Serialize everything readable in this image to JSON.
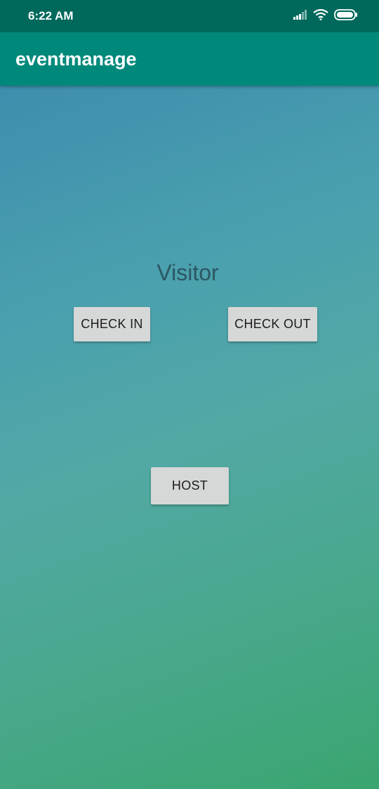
{
  "status_bar": {
    "time": "6:22 AM",
    "icons": [
      "signal-icon",
      "wifi-icon",
      "battery-icon"
    ]
  },
  "app_bar": {
    "title": "eventmanage"
  },
  "main": {
    "section_title": "Visitor",
    "check_in_label": "CHECK IN",
    "check_out_label": "CHECK OUT",
    "host_label": "HOST"
  },
  "colors": {
    "status_bar": "#00695c",
    "app_bar": "#00897b",
    "button_bg": "#d6d7d7",
    "title_text": "#2b5763"
  }
}
